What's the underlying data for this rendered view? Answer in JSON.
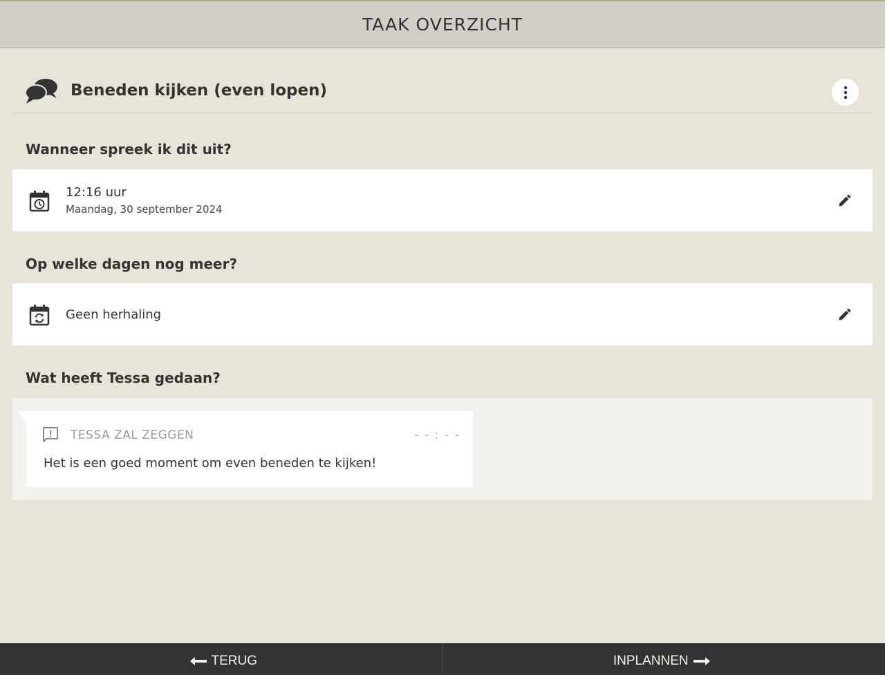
{
  "header": {
    "title": "TAAK OVERZICHT"
  },
  "task": {
    "icon": "chat-bubbles-icon",
    "title": "Beneden kijken (even lopen)",
    "more_icon": "more-vert-icon"
  },
  "sections": {
    "when": {
      "label": "Wanneer spreek ik dit uit?",
      "time": "12:16 uur",
      "date": "Maandag, 30 september 2024",
      "icon": "calendar-clock-icon",
      "edit_icon": "pencil-icon"
    },
    "repeat": {
      "label": "Op welke dagen nog meer?",
      "value": "Geen herhaling",
      "icon": "calendar-repeat-icon",
      "edit_icon": "pencil-icon"
    },
    "activity": {
      "label": "Wat heeft Tessa gedaan?",
      "speech_label": "TESSA ZAL ZEGGEN",
      "speech_time": "- - : - -",
      "speech_text": "Het is een goed moment om even beneden te kijken!",
      "icon": "feedback-icon"
    }
  },
  "footer": {
    "back_label": "TERUG",
    "schedule_label": "INPLANNEN"
  },
  "colors": {
    "background": "#e8e4da",
    "header": "#d2cec8",
    "footer": "#333333",
    "card": "#ffffff"
  }
}
